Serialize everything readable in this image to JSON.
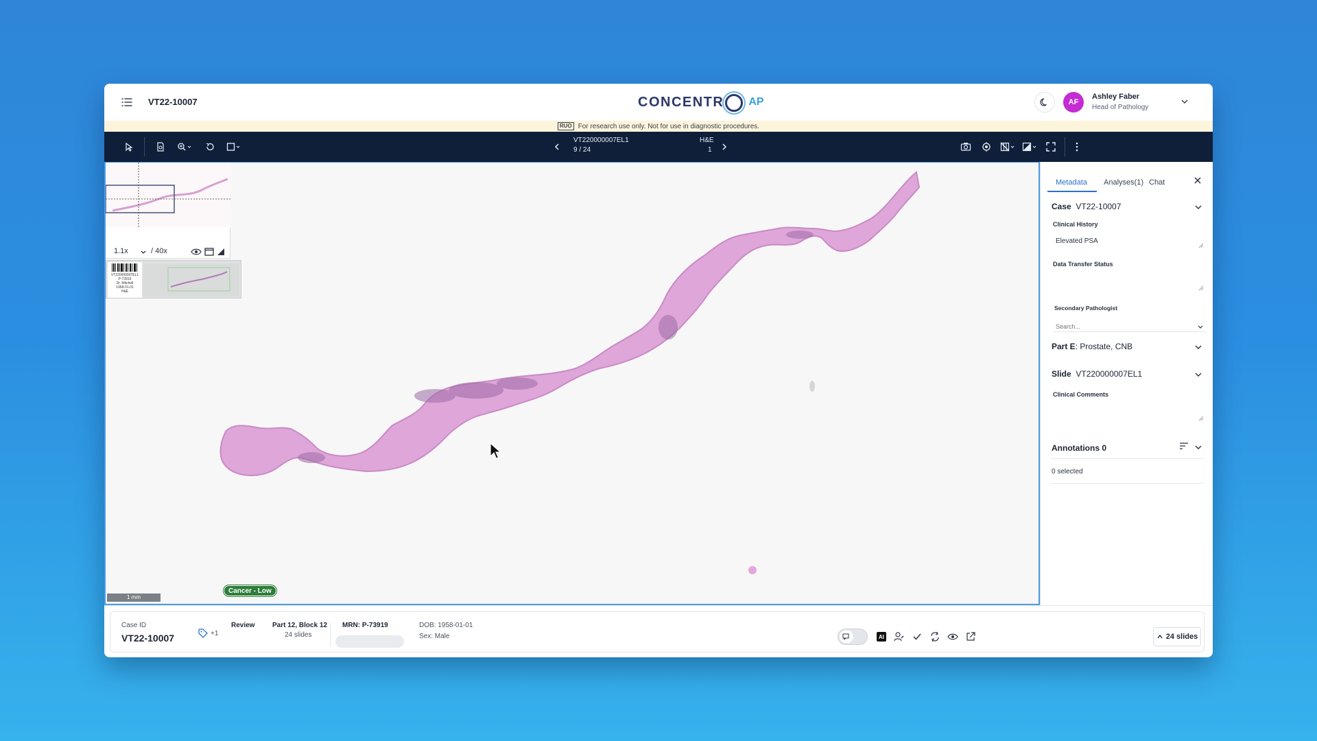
{
  "header": {
    "case_title": "VT22-10007",
    "logo_text_a": "CONCENTR",
    "logo_text_b": "AP",
    "user_initials": "AF",
    "user_name": "Ashley Faber",
    "user_role": "Head of Pathology"
  },
  "banner": {
    "badge": "RUO",
    "text": "For research use only. Not for use in diagnostic procedures."
  },
  "toolbar": {
    "slide_id": "VT220000007EL1",
    "slide_position": "9 / 24",
    "stain": "H&E",
    "stain_index": "1"
  },
  "viewer": {
    "zoom_current": "1.1x",
    "zoom_max": "/ 40x",
    "scale_label": "1 mm",
    "ai_badge": "Cancer - Low",
    "label_lines": [
      "VT220000007EL1",
      "P-73919",
      "Dr. Mitchell",
      "1958-01-01",
      "H&E"
    ]
  },
  "side_panel": {
    "tabs": [
      "Metadata",
      "Analyses(1)",
      "Chat"
    ],
    "case_label": "Case",
    "case_value": "VT22-10007",
    "clinical_history_label": "Clinical History",
    "clinical_history_value": "Elevated PSA",
    "data_transfer_label": "Data Transfer Status",
    "secondary_pathologist_label": "Secondary Pathologist",
    "search_placeholder": "Search...",
    "part_label": "Part E",
    "part_value": ": Prostate, CNB",
    "slide_label": "Slide",
    "slide_value": "VT220000007EL1",
    "clinical_comments_label": "Clinical Comments",
    "annotations_label": "Annotations 0",
    "selected_text": "0 selected"
  },
  "footer": {
    "case_id_label": "Case ID",
    "case_id": "VT22-10007",
    "tag_count": "+1",
    "status": "Review",
    "part_block": "Part 12, Block 12",
    "slides_count": "24 slides",
    "mrn": "MRN: P-73919",
    "dob": "DOB: 1958-01-01",
    "sex": "Sex: Male",
    "slides_button": "24 slides"
  },
  "colors": {
    "toolbar_bg": "#0f1f3a",
    "accent_blue": "#2a72c9",
    "tissue_pink": "#d99ad3",
    "badge_green": "#2e7d3a",
    "avatar_magenta": "#c42bd3"
  }
}
